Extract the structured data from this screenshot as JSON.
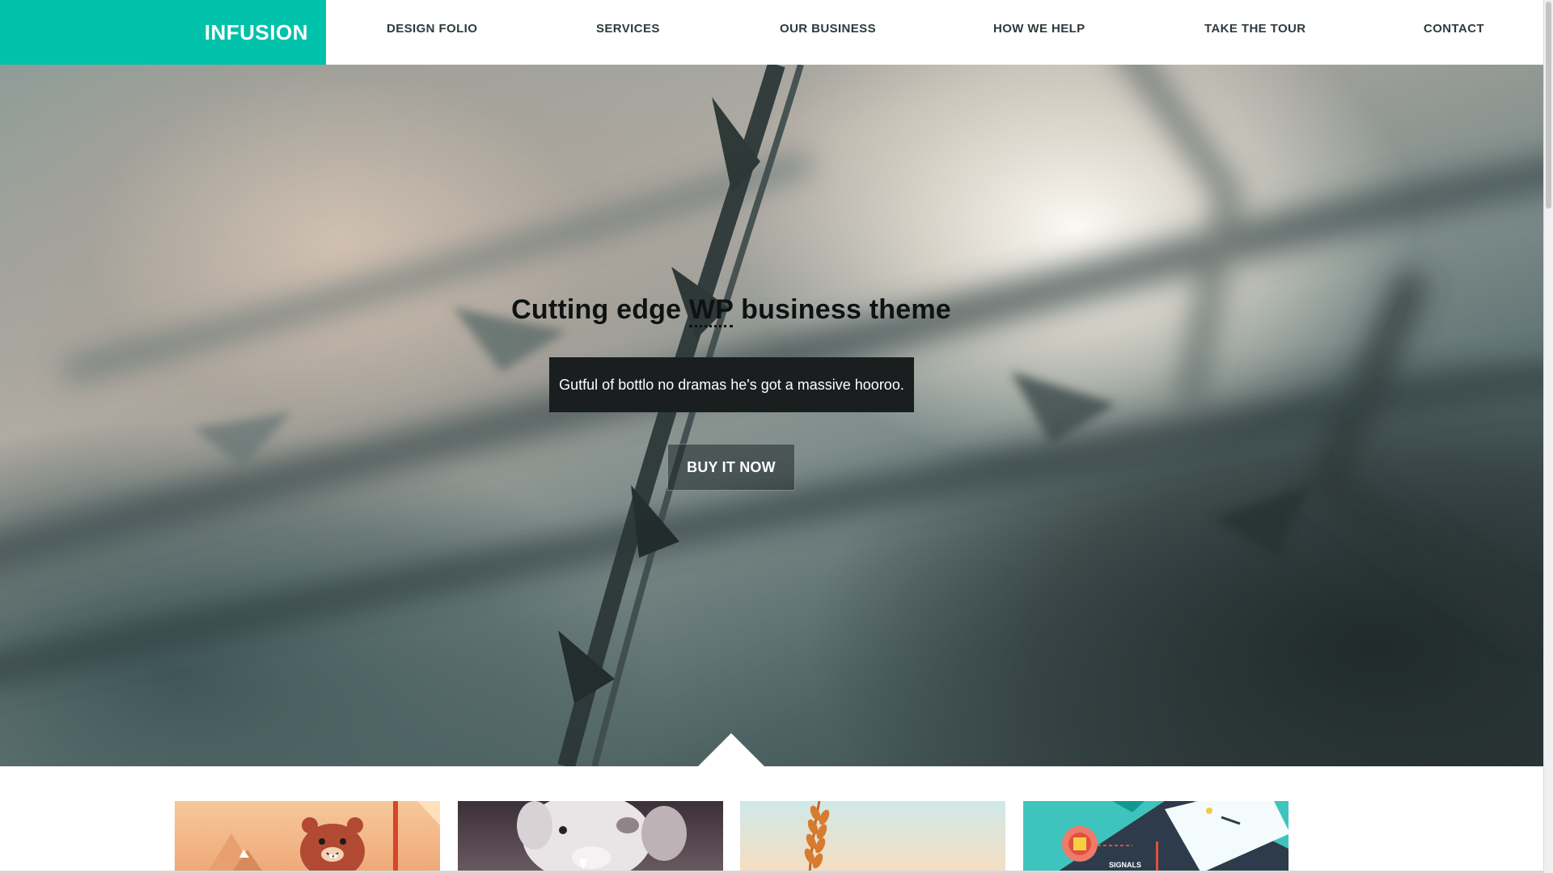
{
  "brand": {
    "logo_text": "INFUSION",
    "accent_color": "#00c2aa"
  },
  "nav": {
    "items": [
      {
        "label": "DESIGN FOLIO"
      },
      {
        "label": "SERVICES"
      },
      {
        "label": "OUR BUSINESS"
      },
      {
        "label": "HOW WE HELP"
      },
      {
        "label": "TAKE THE TOUR"
      },
      {
        "label": "CONTACT"
      }
    ]
  },
  "hero": {
    "title_before": "Cutting edge ",
    "title_abbr": "WP",
    "title_after": " business theme",
    "subtitle": "Gutful of bottlo no dramas he's got a massive hooroo.",
    "cta_label": "BUY IT NOW"
  },
  "portfolio": {
    "items": [
      {
        "icon": "bear-illustration-image"
      },
      {
        "icon": "white-animal-photo-image"
      },
      {
        "icon": "wheat-stalk-photo-image"
      },
      {
        "icon": "smartphone-signals-illustration-image",
        "caption": "SIGNALS"
      }
    ]
  }
}
